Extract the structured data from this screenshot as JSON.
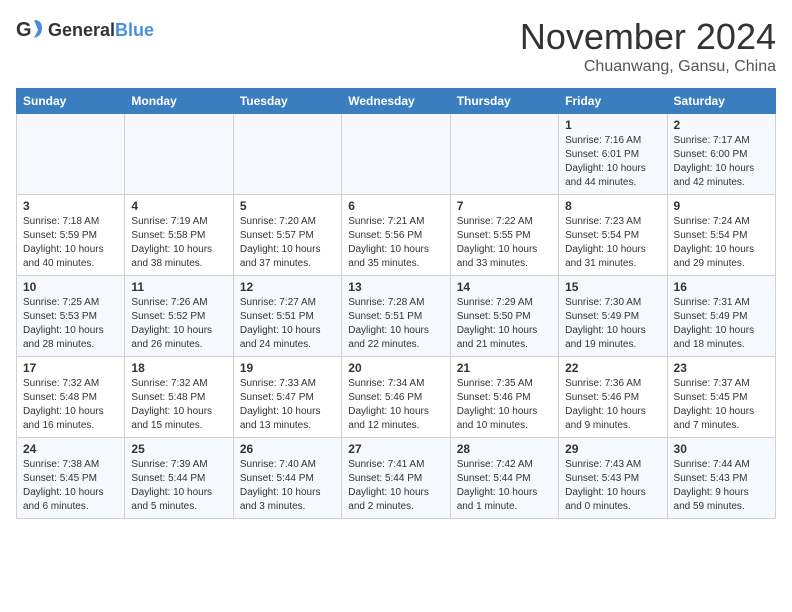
{
  "logo": {
    "general": "General",
    "blue": "Blue"
  },
  "header": {
    "month": "November 2024",
    "location": "Chuanwang, Gansu, China"
  },
  "weekdays": [
    "Sunday",
    "Monday",
    "Tuesday",
    "Wednesday",
    "Thursday",
    "Friday",
    "Saturday"
  ],
  "weeks": [
    [
      {
        "day": "",
        "detail": ""
      },
      {
        "day": "",
        "detail": ""
      },
      {
        "day": "",
        "detail": ""
      },
      {
        "day": "",
        "detail": ""
      },
      {
        "day": "",
        "detail": ""
      },
      {
        "day": "1",
        "detail": "Sunrise: 7:16 AM\nSunset: 6:01 PM\nDaylight: 10 hours\nand 44 minutes."
      },
      {
        "day": "2",
        "detail": "Sunrise: 7:17 AM\nSunset: 6:00 PM\nDaylight: 10 hours\nand 42 minutes."
      }
    ],
    [
      {
        "day": "3",
        "detail": "Sunrise: 7:18 AM\nSunset: 5:59 PM\nDaylight: 10 hours\nand 40 minutes."
      },
      {
        "day": "4",
        "detail": "Sunrise: 7:19 AM\nSunset: 5:58 PM\nDaylight: 10 hours\nand 38 minutes."
      },
      {
        "day": "5",
        "detail": "Sunrise: 7:20 AM\nSunset: 5:57 PM\nDaylight: 10 hours\nand 37 minutes."
      },
      {
        "day": "6",
        "detail": "Sunrise: 7:21 AM\nSunset: 5:56 PM\nDaylight: 10 hours\nand 35 minutes."
      },
      {
        "day": "7",
        "detail": "Sunrise: 7:22 AM\nSunset: 5:55 PM\nDaylight: 10 hours\nand 33 minutes."
      },
      {
        "day": "8",
        "detail": "Sunrise: 7:23 AM\nSunset: 5:54 PM\nDaylight: 10 hours\nand 31 minutes."
      },
      {
        "day": "9",
        "detail": "Sunrise: 7:24 AM\nSunset: 5:54 PM\nDaylight: 10 hours\nand 29 minutes."
      }
    ],
    [
      {
        "day": "10",
        "detail": "Sunrise: 7:25 AM\nSunset: 5:53 PM\nDaylight: 10 hours\nand 28 minutes."
      },
      {
        "day": "11",
        "detail": "Sunrise: 7:26 AM\nSunset: 5:52 PM\nDaylight: 10 hours\nand 26 minutes."
      },
      {
        "day": "12",
        "detail": "Sunrise: 7:27 AM\nSunset: 5:51 PM\nDaylight: 10 hours\nand 24 minutes."
      },
      {
        "day": "13",
        "detail": "Sunrise: 7:28 AM\nSunset: 5:51 PM\nDaylight: 10 hours\nand 22 minutes."
      },
      {
        "day": "14",
        "detail": "Sunrise: 7:29 AM\nSunset: 5:50 PM\nDaylight: 10 hours\nand 21 minutes."
      },
      {
        "day": "15",
        "detail": "Sunrise: 7:30 AM\nSunset: 5:49 PM\nDaylight: 10 hours\nand 19 minutes."
      },
      {
        "day": "16",
        "detail": "Sunrise: 7:31 AM\nSunset: 5:49 PM\nDaylight: 10 hours\nand 18 minutes."
      }
    ],
    [
      {
        "day": "17",
        "detail": "Sunrise: 7:32 AM\nSunset: 5:48 PM\nDaylight: 10 hours\nand 16 minutes."
      },
      {
        "day": "18",
        "detail": "Sunrise: 7:32 AM\nSunset: 5:48 PM\nDaylight: 10 hours\nand 15 minutes."
      },
      {
        "day": "19",
        "detail": "Sunrise: 7:33 AM\nSunset: 5:47 PM\nDaylight: 10 hours\nand 13 minutes."
      },
      {
        "day": "20",
        "detail": "Sunrise: 7:34 AM\nSunset: 5:46 PM\nDaylight: 10 hours\nand 12 minutes."
      },
      {
        "day": "21",
        "detail": "Sunrise: 7:35 AM\nSunset: 5:46 PM\nDaylight: 10 hours\nand 10 minutes."
      },
      {
        "day": "22",
        "detail": "Sunrise: 7:36 AM\nSunset: 5:46 PM\nDaylight: 10 hours\nand 9 minutes."
      },
      {
        "day": "23",
        "detail": "Sunrise: 7:37 AM\nSunset: 5:45 PM\nDaylight: 10 hours\nand 7 minutes."
      }
    ],
    [
      {
        "day": "24",
        "detail": "Sunrise: 7:38 AM\nSunset: 5:45 PM\nDaylight: 10 hours\nand 6 minutes."
      },
      {
        "day": "25",
        "detail": "Sunrise: 7:39 AM\nSunset: 5:44 PM\nDaylight: 10 hours\nand 5 minutes."
      },
      {
        "day": "26",
        "detail": "Sunrise: 7:40 AM\nSunset: 5:44 PM\nDaylight: 10 hours\nand 3 minutes."
      },
      {
        "day": "27",
        "detail": "Sunrise: 7:41 AM\nSunset: 5:44 PM\nDaylight: 10 hours\nand 2 minutes."
      },
      {
        "day": "28",
        "detail": "Sunrise: 7:42 AM\nSunset: 5:44 PM\nDaylight: 10 hours\nand 1 minute."
      },
      {
        "day": "29",
        "detail": "Sunrise: 7:43 AM\nSunset: 5:43 PM\nDaylight: 10 hours\nand 0 minutes."
      },
      {
        "day": "30",
        "detail": "Sunrise: 7:44 AM\nSunset: 5:43 PM\nDaylight: 9 hours\nand 59 minutes."
      }
    ]
  ]
}
